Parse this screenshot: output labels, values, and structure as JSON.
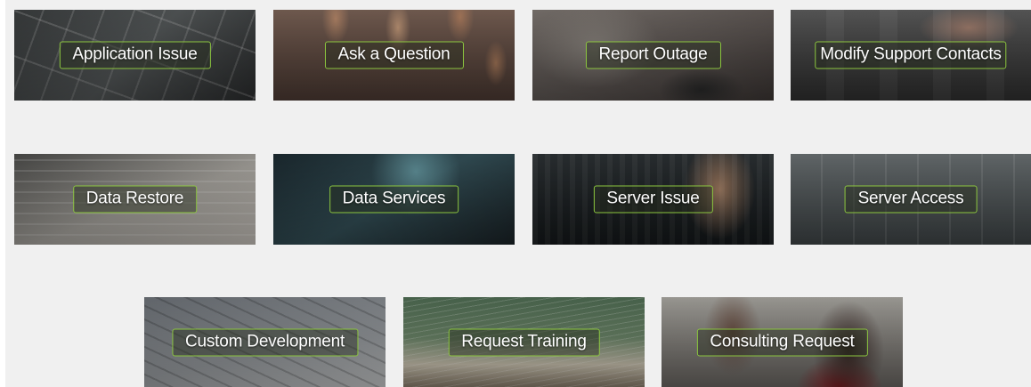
{
  "tiles": [
    {
      "label": "Application Issue"
    },
    {
      "label": "Ask a Question"
    },
    {
      "label": "Report Outage"
    },
    {
      "label": "Modify Support Contacts"
    },
    {
      "label": "Data Restore"
    },
    {
      "label": "Data Services"
    },
    {
      "label": "Server Issue"
    },
    {
      "label": "Server Access"
    },
    {
      "label": "Custom Development"
    },
    {
      "label": "Request Training"
    },
    {
      "label": "Consulting Request"
    }
  ],
  "colors": {
    "panel_background": "#f0f0f0",
    "label_border": "#8cc63f",
    "label_text": "#ffffff"
  }
}
